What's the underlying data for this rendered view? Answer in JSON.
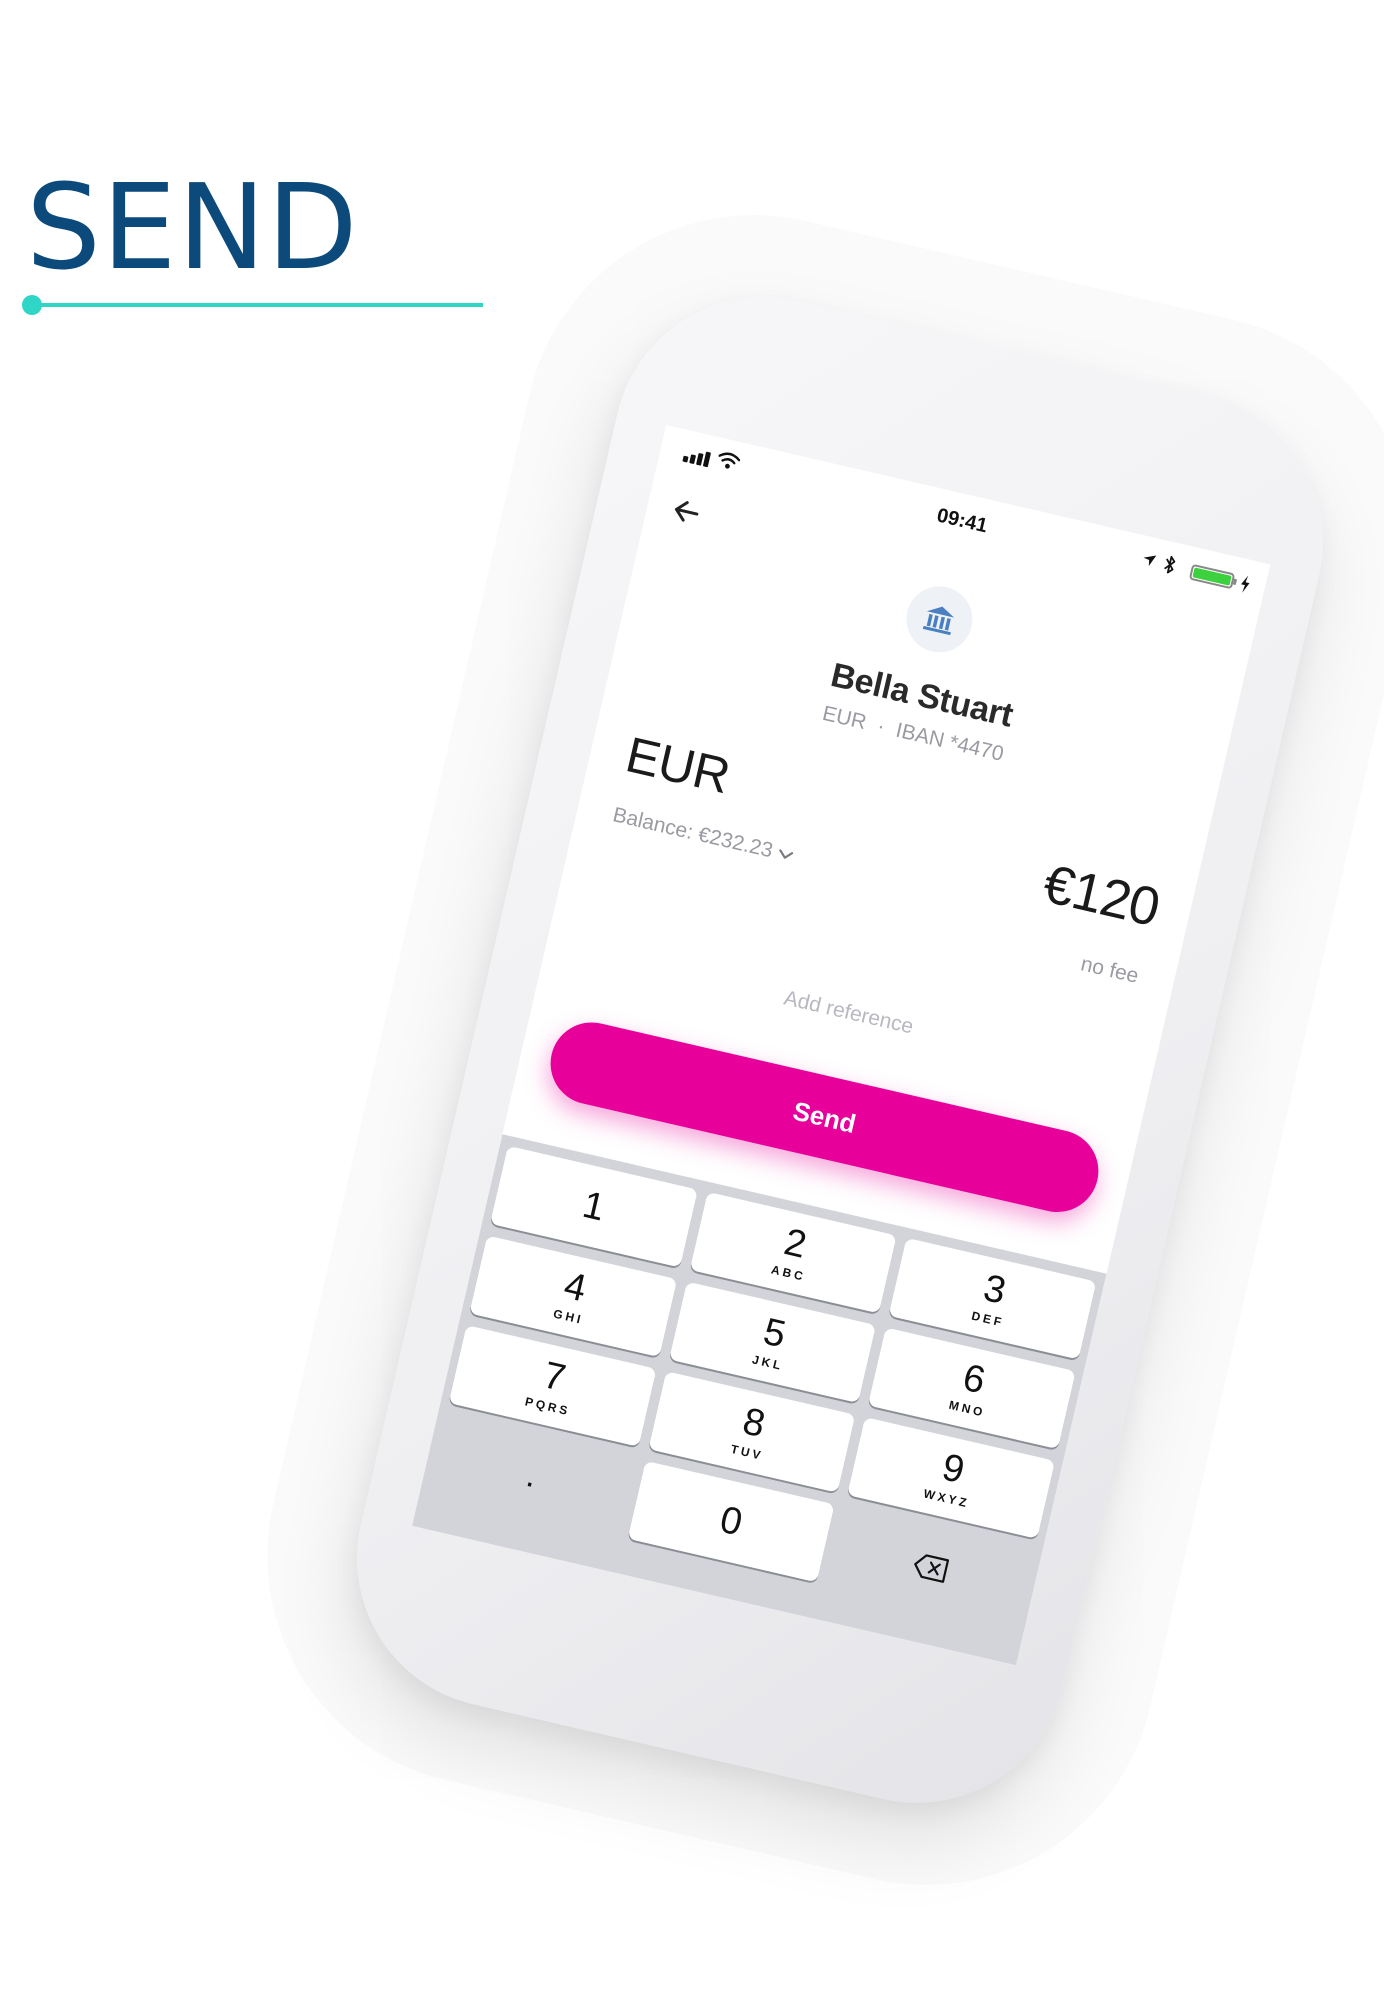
{
  "heading": {
    "title": "SEND"
  },
  "status_bar": {
    "time": "09:41"
  },
  "recipient": {
    "name": "Bella Stuart",
    "currency": "EUR",
    "separator": "·",
    "account": "IBAN *4470"
  },
  "source": {
    "currency": "EUR",
    "balance_label": "Balance: €232.23"
  },
  "amount": {
    "value": "€120",
    "fee": "no fee"
  },
  "reference": {
    "placeholder": "Add reference"
  },
  "actions": {
    "send_label": "Send"
  },
  "keypad": {
    "keys": [
      {
        "digit": "1",
        "letters": ""
      },
      {
        "digit": "2",
        "letters": "ABC"
      },
      {
        "digit": "3",
        "letters": "DEF"
      },
      {
        "digit": "4",
        "letters": "GHI"
      },
      {
        "digit": "5",
        "letters": "JKL"
      },
      {
        "digit": "6",
        "letters": "MNO"
      },
      {
        "digit": "7",
        "letters": "PQRS"
      },
      {
        "digit": "8",
        "letters": "TUV"
      },
      {
        "digit": "9",
        "letters": "WXYZ"
      },
      {
        "digit": ".",
        "letters": ""
      },
      {
        "digit": "0",
        "letters": ""
      }
    ]
  },
  "colors": {
    "heading": "#0d4a7c",
    "accent_line": "#2fd6c6",
    "send_button": "#e8009a",
    "battery": "#3dd13f",
    "keypad_bg": "#d2d4d9"
  },
  "icons": [
    "signal-icon",
    "wifi-icon",
    "location-icon",
    "bluetooth-icon",
    "battery-icon",
    "charging-icon",
    "back-arrow-icon",
    "bank-icon",
    "chevron-down-icon",
    "backspace-icon"
  ]
}
